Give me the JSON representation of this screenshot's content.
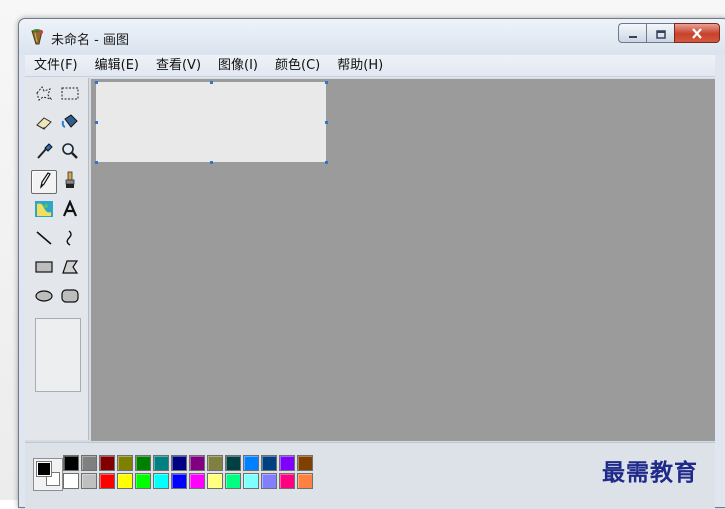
{
  "window": {
    "title": "未命名 - 画图",
    "app_icon": "paint-bucket-icon"
  },
  "caption_buttons": {
    "minimize_icon": "minimize-icon",
    "maximize_icon": "maximize-icon",
    "close_icon": "close-icon"
  },
  "menu": {
    "items": [
      {
        "label": "文件(F)"
      },
      {
        "label": "编辑(E)"
      },
      {
        "label": "查看(V)"
      },
      {
        "label": "图像(I)"
      },
      {
        "label": "颜色(C)"
      },
      {
        "label": "帮助(H)"
      }
    ]
  },
  "toolbox": {
    "tools": [
      {
        "name": "free-form-select-icon"
      },
      {
        "name": "rect-select-icon"
      },
      {
        "name": "eraser-icon"
      },
      {
        "name": "fill-bucket-icon"
      },
      {
        "name": "eyedropper-icon"
      },
      {
        "name": "magnifier-icon"
      },
      {
        "name": "pencil-icon",
        "selected": true
      },
      {
        "name": "brush-icon"
      },
      {
        "name": "airbrush-icon"
      },
      {
        "name": "text-tool-icon",
        "glyph": "A"
      },
      {
        "name": "line-icon"
      },
      {
        "name": "curve-icon"
      },
      {
        "name": "rectangle-icon"
      },
      {
        "name": "polygon-icon"
      },
      {
        "name": "ellipse-icon"
      },
      {
        "name": "rounded-rect-icon"
      }
    ]
  },
  "palette": {
    "foreground": "#000000",
    "background": "#ffffff",
    "row1": [
      "#000000",
      "#808080",
      "#800000",
      "#808000",
      "#008000",
      "#008080",
      "#000080",
      "#800080",
      "#808040",
      "#004040",
      "#0080ff",
      "#004080",
      "#8000ff",
      "#804000"
    ],
    "row2": [
      "#ffffff",
      "#c0c0c0",
      "#ff0000",
      "#ffff00",
      "#00ff00",
      "#00ffff",
      "#0000ff",
      "#ff00ff",
      "#ffff80",
      "#00ff80",
      "#80ffff",
      "#8080ff",
      "#ff0080",
      "#ff8040"
    ]
  },
  "watermark": "最需教育"
}
